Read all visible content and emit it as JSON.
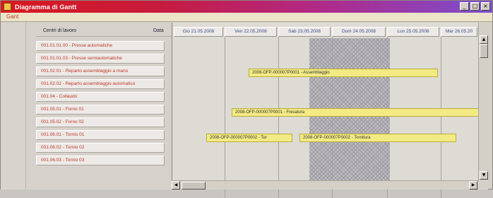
{
  "window": {
    "title": "Diagramma di Gantt",
    "menu": [
      "Gant"
    ]
  },
  "left_panel": {
    "header_label": "Centri di lavoro",
    "header_date": "Data",
    "rows": [
      "001.01.01.00 - Presse automatiche",
      "001.01.01.03 - Presse semiautomatiche",
      "001.02.01 - Reparto assemblaggio a mano",
      "001.02.02 - Reparto assemblaggio automatico",
      "001.04 - Collaudo",
      "001.05.01 - Forno 01",
      "001.05.02 - Forno 02",
      "001.06.01 - Tornio 01",
      "001.06.02 - Tornio 02",
      "001.06.03 - Tornio 03"
    ]
  },
  "gantt": {
    "date_columns": [
      "Gio 21.05.2008",
      "Ven 22.05.2008",
      "Sab 23.05.2008",
      "Dom 24.05.2008",
      "Lun 25.05.2008",
      "Mar 26.05.20"
    ],
    "bars": [
      {
        "label": "2008-OFP-000007P0001 - Assemblaggio"
      },
      {
        "label": "2008-OFP-000007P0001 - Fresatura"
      },
      {
        "label": "2008-OFP-000007P0002 - Tor"
      },
      {
        "label": "2008-OFP-000007P0002 - Tornitura"
      }
    ]
  },
  "icons": {
    "app": "gantt-app-icon",
    "minimize": "minimize-icon",
    "maximize": "maximize-icon",
    "close": "close-icon"
  },
  "colors": {
    "title_gradient_start": "#d8191f",
    "title_gradient_end": "#7b4fd0",
    "row_text": "#c0392b",
    "bar_fill": "#f3ea84"
  }
}
